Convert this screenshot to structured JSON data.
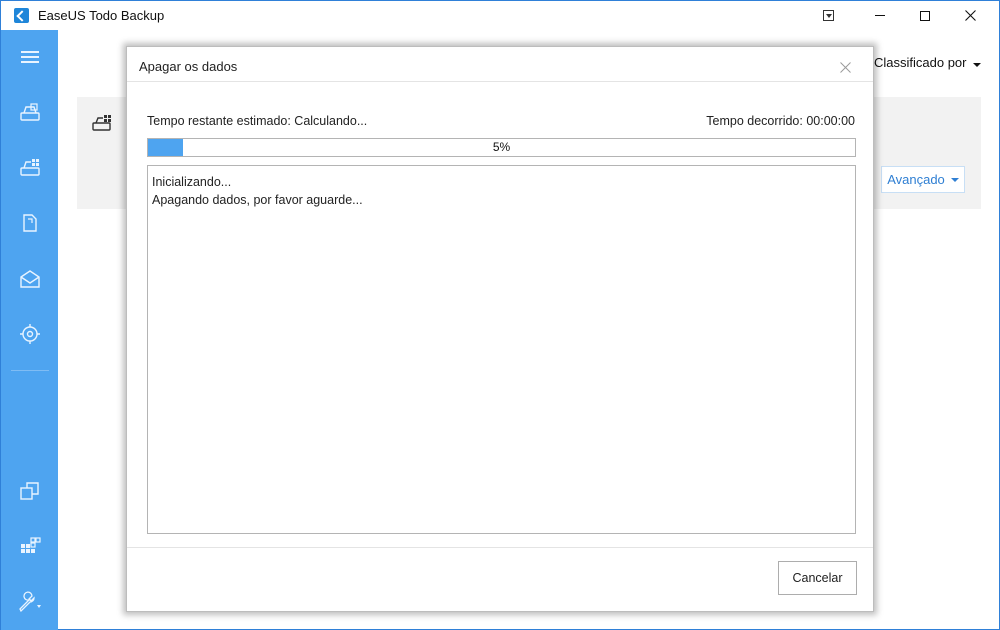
{
  "app": {
    "title": "EaseUS Todo Backup",
    "accent_color": "#4ea4f0"
  },
  "titlebar": {
    "icons": [
      "menu-dropdown-icon",
      "minimize-icon",
      "maximize-icon",
      "close-icon"
    ]
  },
  "sidebar": {
    "items": [
      {
        "icon": "hamburger-menu-icon"
      },
      {
        "icon": "disk-backup-icon"
      },
      {
        "icon": "system-backup-icon"
      },
      {
        "icon": "file-backup-icon"
      },
      {
        "icon": "mail-backup-icon"
      },
      {
        "icon": "smart-backup-icon"
      },
      {
        "icon": "clone-icon"
      },
      {
        "icon": "tools-grid-icon"
      },
      {
        "icon": "wrench-settings-icon"
      }
    ]
  },
  "background": {
    "sort_label": "Classificado por",
    "advanced_label": "Avançado"
  },
  "dialog": {
    "title": "Apagar os dados",
    "estimated_label": "Tempo restante estimado: Calculando...",
    "elapsed_label": "Tempo decorrido: 00:00:00",
    "progress_percent": 5,
    "progress_text": "5%",
    "log_lines": [
      "Inicializando...",
      "Apagando dados, por favor aguarde..."
    ],
    "cancel_label": "Cancelar"
  }
}
